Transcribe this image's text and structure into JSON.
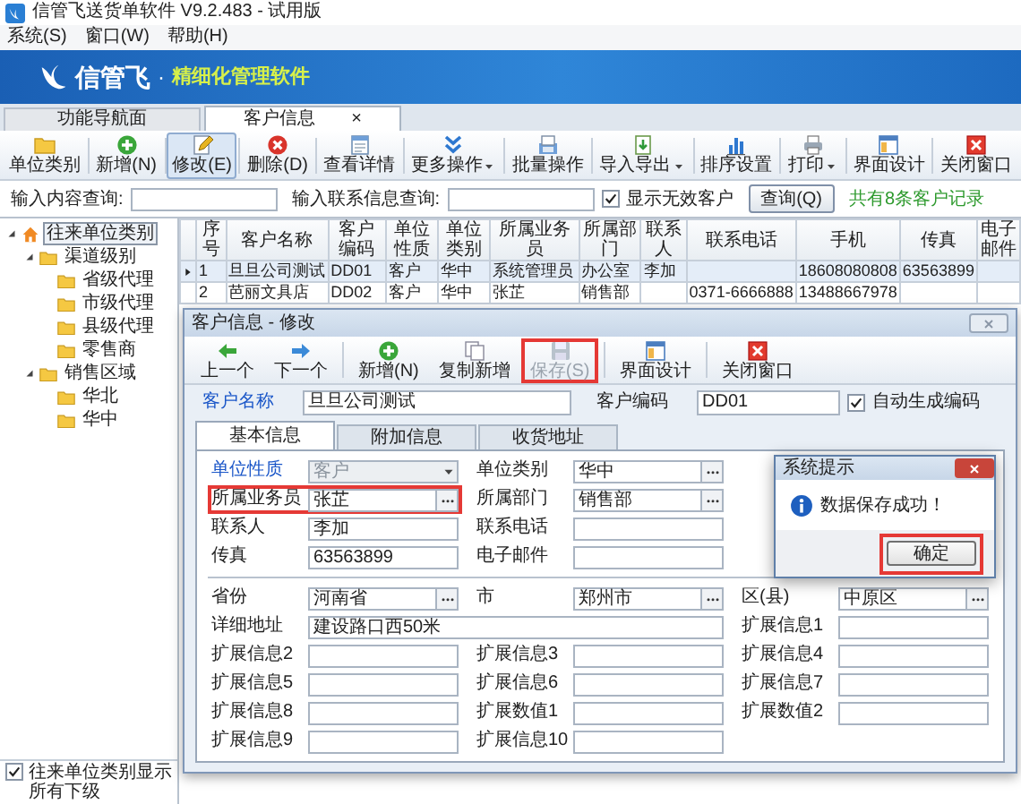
{
  "window": {
    "title": "信管飞送货单软件 V9.2.483 - 试用版"
  },
  "menu": [
    "系统(S)",
    "窗口(W)",
    "帮助(H)"
  ],
  "banner": {
    "brand": "信管飞",
    "separator": "·",
    "slogan": "精细化管理软件"
  },
  "doc_tabs": [
    {
      "label": "功能导航面",
      "selected": false
    },
    {
      "label": "客户信息",
      "selected": true,
      "close": "×"
    }
  ],
  "toolbar": [
    {
      "label": "单位类别",
      "selected": false,
      "has_menu": false
    },
    {
      "label": "新增(N)",
      "selected": false,
      "has_menu": false
    },
    {
      "label": "修改(E)",
      "selected": true,
      "has_menu": false
    },
    {
      "label": "删除(D)",
      "selected": false,
      "has_menu": false
    },
    {
      "label": "查看详情",
      "selected": false,
      "has_menu": false
    },
    {
      "label": "更多操作",
      "selected": false,
      "has_menu": true
    },
    {
      "label": "批量操作",
      "selected": false,
      "has_menu": false
    },
    {
      "label": "导入导出",
      "selected": false,
      "has_menu": true
    },
    {
      "label": "排序设置",
      "selected": false,
      "has_menu": false
    },
    {
      "label": "打印",
      "selected": false,
      "has_menu": true
    },
    {
      "label": "界面设计",
      "selected": false,
      "has_menu": false
    },
    {
      "label": "关闭窗口",
      "selected": false,
      "has_menu": false
    }
  ],
  "search": {
    "content_label": "输入内容查询:",
    "contact_label": "输入联系信息查询:",
    "show_invalid": {
      "label": "显示无效客户",
      "checked": true
    },
    "query_button": "查询(Q)",
    "summary": "共有8条客户记录"
  },
  "tree": {
    "label": "往来单位类别",
    "selected": true,
    "expanded": true,
    "children": [
      {
        "label": "渠道级别",
        "selected": false,
        "expanded": true,
        "children": [
          {
            "label": "省级代理",
            "selected": false
          },
          {
            "label": "市级代理",
            "selected": false
          },
          {
            "label": "县级代理",
            "selected": false
          },
          {
            "label": "零售商",
            "selected": false
          }
        ]
      },
      {
        "label": "销售区域",
        "selected": false,
        "expanded": true,
        "children": [
          {
            "label": "华北",
            "selected": false
          },
          {
            "label": "华中",
            "selected": false
          }
        ]
      }
    ]
  },
  "tree_footer": {
    "label": "往来单位类别显示所有下级",
    "checked": true
  },
  "table": {
    "columns": [
      "序号",
      "客户名称",
      "客户编码",
      "单位性质",
      "单位类别",
      "所属业务员",
      "所属部门",
      "联系人",
      "联系电话",
      "手机",
      "传真",
      "电子邮件"
    ],
    "rows": [
      {
        "selected": true,
        "cells": [
          "1",
          "旦旦公司测试",
          "DD01",
          "客户",
          "华中",
          "系统管理员",
          "办公室",
          "李加",
          null,
          "18608080808",
          "63563899",
          null
        ]
      },
      {
        "selected": false,
        "cells": [
          "2",
          "芭丽文具店",
          "DD02",
          "客户",
          "华中",
          "张芷",
          "销售部",
          null,
          "0371-6666888",
          "13488667978",
          null,
          null
        ]
      }
    ]
  },
  "dialog": {
    "title": "客户信息 - 修改",
    "toolbar": [
      {
        "label": "上一个",
        "disabled": false,
        "highlighted": false
      },
      {
        "label": "下一个",
        "disabled": false,
        "highlighted": false
      },
      {
        "label": "新增(N)",
        "disabled": false,
        "highlighted": false
      },
      {
        "label": "复制新增",
        "disabled": false,
        "highlighted": false
      },
      {
        "label": "保存(S)",
        "disabled": true,
        "highlighted": true
      },
      {
        "label": "界面设计",
        "disabled": false,
        "highlighted": false
      },
      {
        "label": "关闭窗口",
        "disabled": false,
        "highlighted": false
      }
    ],
    "name": {
      "label": "客户名称",
      "value": "旦旦公司测试",
      "required": true
    },
    "code": {
      "label": "客户编码",
      "value": "DD01",
      "required": false
    },
    "auto_code": {
      "label": "自动生成编码",
      "checked": true
    },
    "tabs": [
      {
        "label": "基本信息",
        "selected": true
      },
      {
        "label": "附加信息",
        "selected": false
      },
      {
        "label": "收货地址",
        "selected": false
      }
    ],
    "sections": [
      {
        "rows": [
          [
            {
              "kind": "select",
              "label": "单位性质",
              "value": "客户",
              "required": true,
              "disabled": true,
              "highlighted": false
            },
            {
              "kind": "lookup",
              "label": "单位类别",
              "value": "华中",
              "required": false,
              "disabled": false,
              "highlighted": false
            }
          ],
          [
            {
              "kind": "lookup",
              "label": "所属业务员",
              "value": "张芷",
              "required": false,
              "disabled": false,
              "highlighted": true
            },
            {
              "kind": "lookup",
              "label": "所属部门",
              "value": "销售部",
              "required": false,
              "disabled": false,
              "highlighted": false
            }
          ],
          [
            {
              "kind": "text",
              "label": "联系人",
              "value": "李加",
              "required": false,
              "disabled": false,
              "highlighted": false
            },
            {
              "kind": "text",
              "label": "联系电话",
              "required": false,
              "disabled": false,
              "highlighted": false
            }
          ],
          [
            {
              "kind": "text",
              "label": "传真",
              "value": "63563899",
              "required": false,
              "disabled": false,
              "highlighted": false
            },
            {
              "kind": "text",
              "label": "电子邮件",
              "required": false,
              "disabled": false,
              "highlighted": false
            }
          ]
        ]
      },
      {
        "rows": [
          [
            {
              "kind": "lookup",
              "label": "省份",
              "value": "河南省",
              "required": false,
              "disabled": false,
              "highlighted": false
            },
            {
              "kind": "lookup",
              "label": "市",
              "value": "郑州市",
              "required": false,
              "disabled": false,
              "highlighted": false
            },
            {
              "kind": "lookup",
              "label": "区(县)",
              "value": "中原区",
              "required": false,
              "disabled": false,
              "highlighted": false
            }
          ],
          [
            {
              "kind": "wide",
              "label": "详细地址",
              "value": "建设路口西50米",
              "required": false,
              "disabled": false,
              "highlighted": false
            },
            "",
            {
              "kind": "text",
              "label": "扩展信息1",
              "required": false,
              "disabled": false,
              "highlighted": false
            }
          ],
          [
            {
              "kind": "text",
              "label": "扩展信息2",
              "required": false,
              "disabled": false,
              "highlighted": false
            },
            {
              "kind": "text",
              "label": "扩展信息3",
              "required": false,
              "disabled": false,
              "highlighted": false
            },
            {
              "kind": "text",
              "label": "扩展信息4",
              "required": false,
              "disabled": false,
              "highlighted": false
            }
          ],
          [
            {
              "kind": "text",
              "label": "扩展信息5",
              "required": false,
              "disabled": false,
              "highlighted": false
            },
            {
              "kind": "text",
              "label": "扩展信息6",
              "required": false,
              "disabled": false,
              "highlighted": false
            },
            {
              "kind": "text",
              "label": "扩展信息7",
              "required": false,
              "disabled": false,
              "highlighted": false
            }
          ],
          [
            {
              "kind": "text",
              "label": "扩展信息8",
              "required": false,
              "disabled": false,
              "highlighted": false
            },
            {
              "kind": "text",
              "label": "扩展数值1",
              "required": false,
              "disabled": false,
              "highlighted": false
            },
            {
              "kind": "text",
              "label": "扩展数值2",
              "required": false,
              "disabled": false,
              "highlighted": false
            }
          ],
          [
            {
              "kind": "text",
              "label": "扩展信息9",
              "required": false,
              "disabled": false,
              "highlighted": false
            },
            {
              "kind": "text",
              "label": "扩展信息10",
              "required": false,
              "disabled": false,
              "highlighted": false
            }
          ]
        ]
      }
    ]
  },
  "message_box": {
    "title": "系统提示",
    "message": "数据保存成功！",
    "button": {
      "label": "确定",
      "highlighted": true
    }
  }
}
